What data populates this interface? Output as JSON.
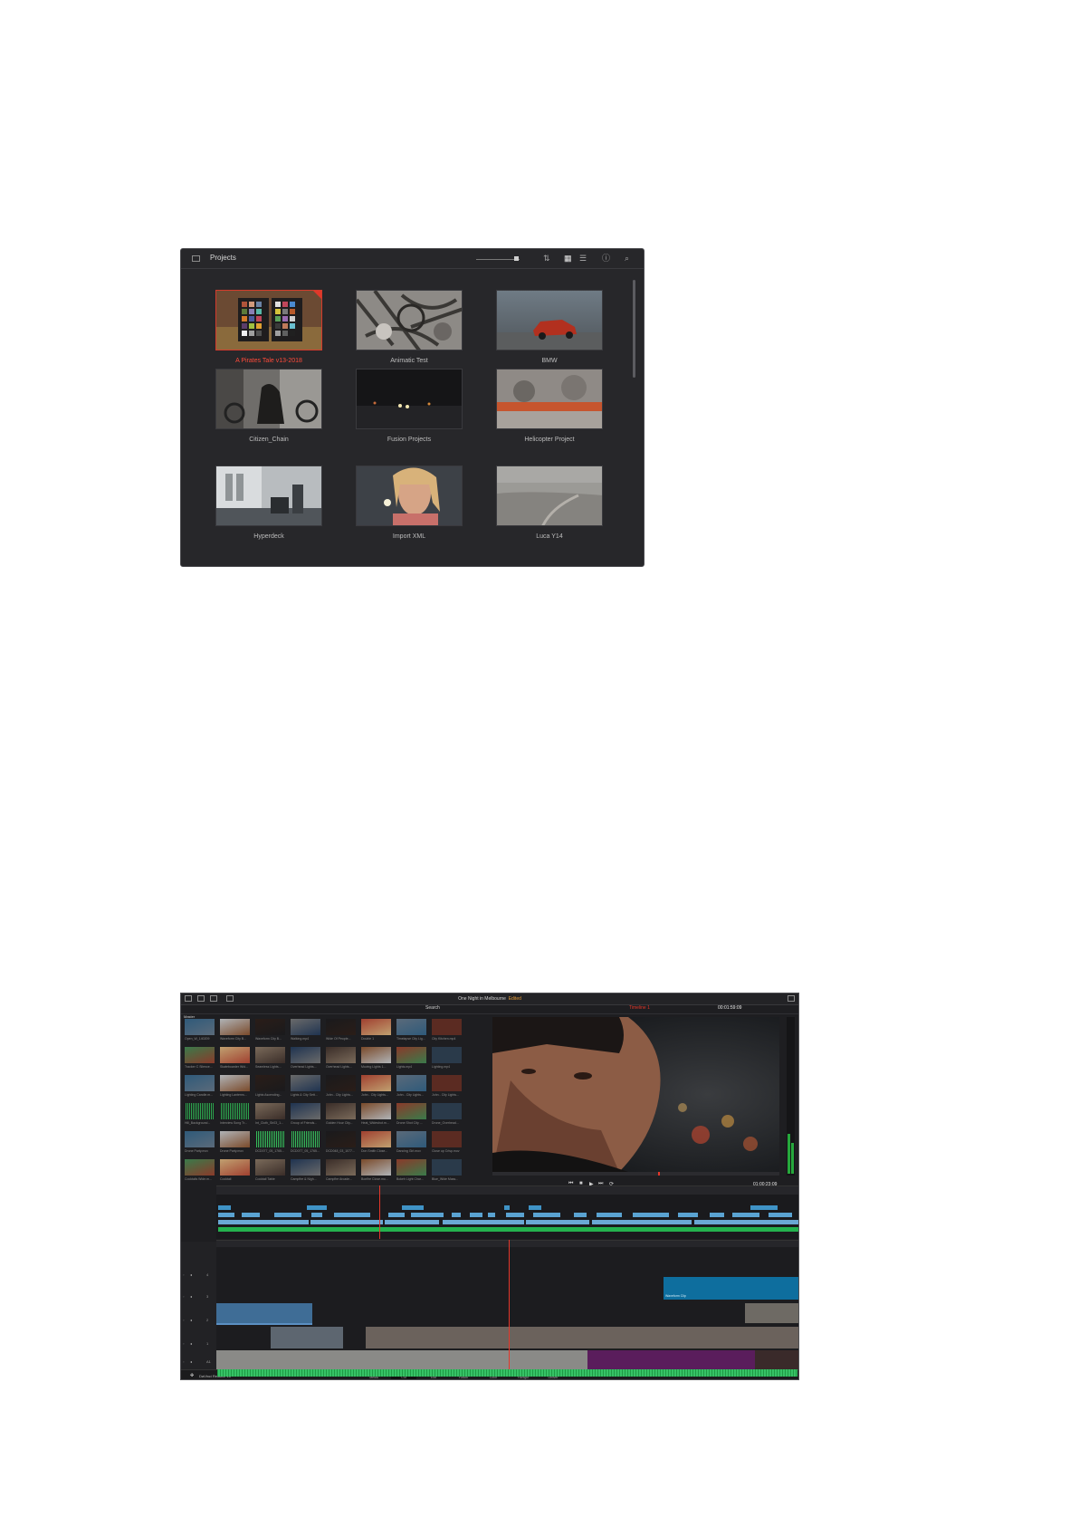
{
  "project_manager": {
    "title": "Projects",
    "projects": [
      {
        "name": "A Pirates Tale v13-2018",
        "selected": true
      },
      {
        "name": "Animatic Test",
        "selected": false
      },
      {
        "name": "BMW",
        "selected": false
      },
      {
        "name": "Citizen_Chain",
        "selected": false
      },
      {
        "name": "Fusion Projects",
        "selected": false
      },
      {
        "name": "Helicopter Project",
        "selected": false
      },
      {
        "name": "Hyperdeck",
        "selected": false
      },
      {
        "name": "Import XML",
        "selected": false
      },
      {
        "name": "Luca Y14",
        "selected": false
      }
    ],
    "icons": [
      "sidebar-toggle-icon",
      "sort-icon",
      "grid-view-icon",
      "list-view-icon",
      "info-icon",
      "search-icon"
    ]
  },
  "cut_page": {
    "project_title": "One Night in Melbourne",
    "edited_label": "Edited",
    "bin_label": "Master",
    "search_label": "Search",
    "timeline_name": "Timeline 1",
    "source_timecode": "00:01:59:09",
    "timeline_timecode": "01:00:23:09",
    "app_name": "DaVinci Resolve 15",
    "pages": [
      {
        "label": "Media",
        "icon": "media-page-icon",
        "active": false
      },
      {
        "label": "Cut",
        "icon": "cut-page-icon",
        "active": true
      },
      {
        "label": "Edit",
        "icon": "edit-page-icon",
        "active": false
      },
      {
        "label": "Fusion",
        "icon": "fusion-page-icon",
        "active": false
      },
      {
        "label": "Color",
        "icon": "color-page-icon",
        "active": false
      },
      {
        "label": "Fairlight",
        "icon": "fairlight-page-icon",
        "active": false
      },
      {
        "label": "Deliver",
        "icon": "deliver-page-icon",
        "active": false
      }
    ],
    "media_clips": [
      "Open_W_140209",
      "Waveform City B...",
      "Waveform City B...",
      "Walking.mp4",
      "Wide Of People...",
      "Double 1",
      "Timelapse City Lig...",
      "City Kitchen.mp4",
      "Tracker C Silence...",
      "Skateboarder Wid...",
      "Seamless Lights...",
      "Overhead Lights...",
      "Overhead Lights...",
      "Moving Lights 1...",
      "Lights.mp4",
      "Lighting.mp4",
      "Lighting Candle.m...",
      "Lighting Lanterns...",
      "Lights Ascending...",
      "Lights & City Sett...",
      "John - City Lights...",
      "John - City Lights...",
      "John - City Lights...",
      "John - City Lights...",
      "Hill_Background...",
      "Interview Song Tr...",
      "Int_Cloth_Sh03_1...",
      "Group of Friends...",
      "Golden Hour City...",
      "Heat_Wideshot.m...",
      "Drone Shot City ...",
      "Drone_Overhead...",
      "Drone Party.mov",
      "Drone Party.mov",
      "DCD077_05_1765...",
      "DCD077_05_1765...",
      "DCD048_03_1077...",
      "Don Smith Close...",
      "Dancing Girl.mov",
      "Close up Crisp.mov",
      "Cocktails Wide.m...",
      "Cocktail",
      "Cocktail Table",
      "Campfire & Nigh...",
      "Campfire Arcade...",
      "Bonfire Close.mo...",
      "Bokeh Light Char...",
      "Blue_Wide Mass..."
    ],
    "overlay_clip_label": "Waveform Clip",
    "track_numbers": [
      "4",
      "3",
      "2",
      "1",
      "A1"
    ]
  }
}
